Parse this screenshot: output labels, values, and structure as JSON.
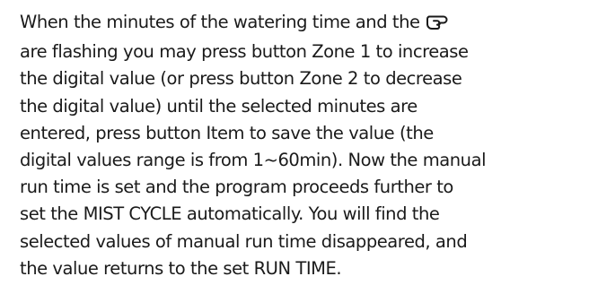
{
  "paragraph": {
    "line_1_text": "When the minutes of the watering time and the",
    "line_1_icon": "hand-pointer-icon",
    "lines": [
      "are flashing you may press button Zone 1 to increase",
      "the digital value (or press button Zone 2 to decrease",
      "the digital value) until the selected minutes are",
      "entered, press button Item to save the value (the",
      "digital values range is from 1~60min). Now the manual",
      "run time is set and the program proceeds further to",
      "set the MIST CYCLE automatically. You will find the",
      "selected values of manual run time disappeared, and",
      "the value returns to the set RUN TIME."
    ]
  }
}
